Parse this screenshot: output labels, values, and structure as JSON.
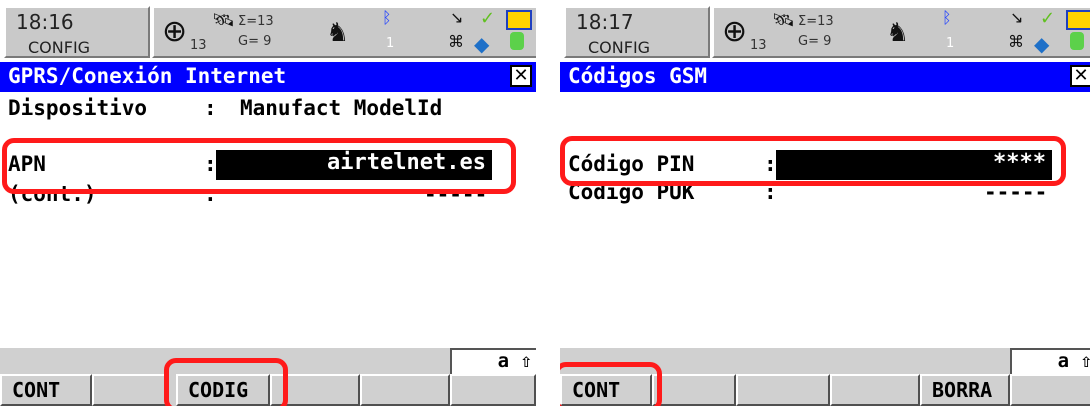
{
  "screens": [
    {
      "time": "18:16",
      "mode": "CONFIG",
      "sat_count_a": "13",
      "sat_sum": "Σ=13",
      "sat_g": "G= 9",
      "title": "GPRS/Conexión Internet",
      "close_glyph": "✕",
      "rows": [
        {
          "label": "Dispositivo",
          "colon": ":",
          "value": "Manufact ModelId"
        },
        {
          "label": "APN",
          "colon": ":",
          "value": "airtelnet.es"
        },
        {
          "label": "(cont.)",
          "colon": ":",
          "value": "-----"
        }
      ],
      "shift_indicator": "a ⇧",
      "softkeys": [
        "CONT",
        "",
        "CODIG",
        "",
        "",
        ""
      ]
    },
    {
      "time": "18:17",
      "mode": "CONFIG",
      "sat_count_a": "13",
      "sat_sum": "Σ=13",
      "sat_g": "G= 9",
      "title": "Códigos GSM",
      "close_glyph": "✕",
      "rows": [
        {
          "label": "Código PIN",
          "colon": ":",
          "value": "****"
        },
        {
          "label": "Código PUK",
          "colon": ":",
          "value": "-----"
        }
      ],
      "shift_indicator": "a ⇧",
      "softkeys": [
        "CONT",
        "",
        "",
        "",
        "BORRA",
        ""
      ]
    }
  ],
  "colors": {
    "title_bar": "#0000ff",
    "highlight": "#ff1a1a",
    "softkey_bg": "#d0d0d0",
    "input_bg": "#000000"
  },
  "icons": [
    "crosshair-icon",
    "satellite-icon",
    "rover-icon",
    "bluetooth-icon",
    "radio-icon",
    "antenna-icon",
    "stylus-icon",
    "battery-icon",
    "memory-card-icon",
    "device-icon"
  ]
}
